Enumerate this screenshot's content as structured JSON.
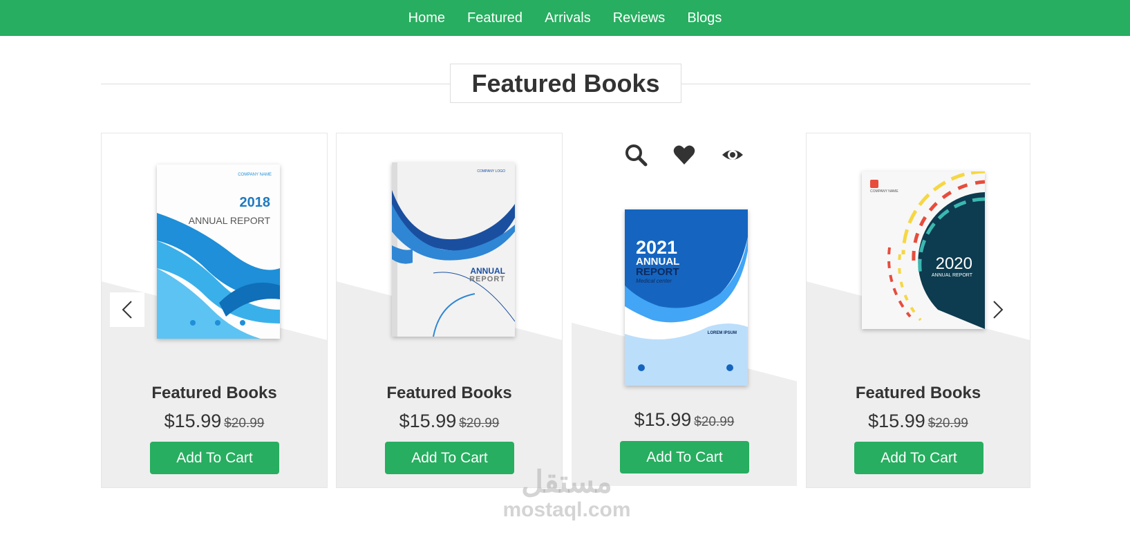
{
  "nav": {
    "items": [
      "Home",
      "Featured",
      "Arrivals",
      "Reviews",
      "Blogs"
    ]
  },
  "section": {
    "heading": "Featured Books"
  },
  "products": [
    {
      "title": "Featured Books",
      "price": "$15.99",
      "old_price": "$20.99",
      "button": "Add To Cart",
      "cover": {
        "year": "2018",
        "label": "ANNUAL REPORT",
        "company": "COMPANY NAME"
      }
    },
    {
      "title": "Featured Books",
      "price": "$15.99",
      "old_price": "$20.99",
      "button": "Add To Cart",
      "cover": {
        "line1": "ANNUAL",
        "line2": "REPORT",
        "company": "COMPANY LOGO"
      }
    },
    {
      "title": "Featured Books",
      "price": "$15.99",
      "old_price": "$20.99",
      "button": "Add To Cart",
      "cover": {
        "year": "2021",
        "line1": "ANNUAL",
        "line2": "REPORT",
        "sub": "Medical center",
        "side": "LOREM IPSUM"
      }
    },
    {
      "title": "Featured Books",
      "price": "$15.99",
      "old_price": "$20.99",
      "button": "Add To Cart",
      "cover": {
        "year": "2020",
        "label": "ANNUAL REPORT",
        "company": "COMPANY NAME"
      }
    }
  ],
  "hover_icons": [
    "search-icon",
    "heart-icon",
    "eye-icon"
  ],
  "watermark": {
    "arabic": "مستقل",
    "latin": "mostaql.com"
  },
  "colors": {
    "accent": "#27ae60",
    "card_bg": "#eeeeee"
  }
}
